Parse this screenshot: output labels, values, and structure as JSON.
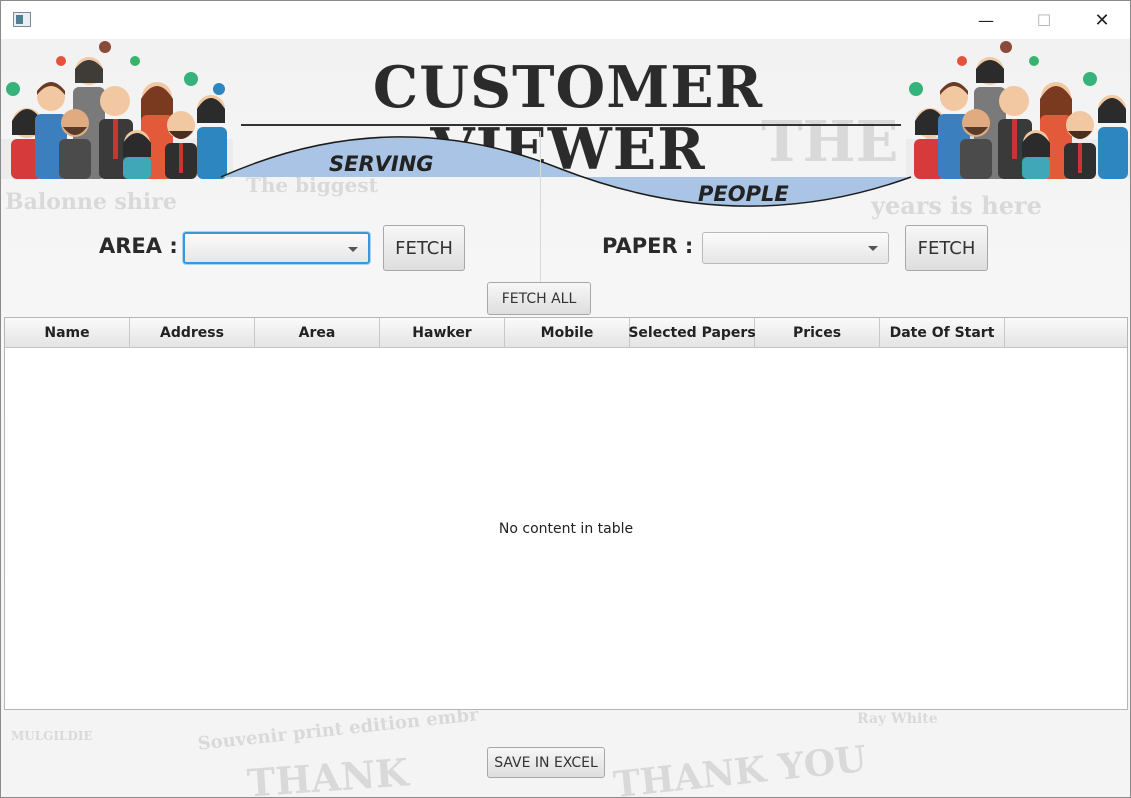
{
  "window": {
    "controls": {
      "minimize": "—",
      "maximize": "☐",
      "close": "✕"
    }
  },
  "header": {
    "title": "CUSTOMER VIEWER",
    "wave_left": "SERVING",
    "wave_right": "PEOPLE"
  },
  "background_text": [
    "Balonne shire",
    "The biggest",
    "THE ED",
    "years is here",
    "Souvenir print edition embr",
    "THANK",
    "THANK YOU",
    "MULGILDIE",
    "Ray White"
  ],
  "filters": {
    "area_label": "AREA :",
    "area_value": "",
    "paper_label": "PAPER :",
    "paper_value": "",
    "fetch_area": "FETCH",
    "fetch_paper": "FETCH",
    "fetch_all": "FETCH ALL"
  },
  "table": {
    "columns": [
      "Name",
      "Address",
      "Area",
      "Hawker",
      "Mobile",
      "Selected Papers",
      "Prices",
      "Date Of Start"
    ],
    "placeholder": "No content in table"
  },
  "footer": {
    "save_excel": "SAVE IN EXCEL"
  },
  "colors": {
    "wave_fill": "#a9c4e4",
    "focus_border": "#3a98d6",
    "title_color": "#2b2b2b"
  }
}
